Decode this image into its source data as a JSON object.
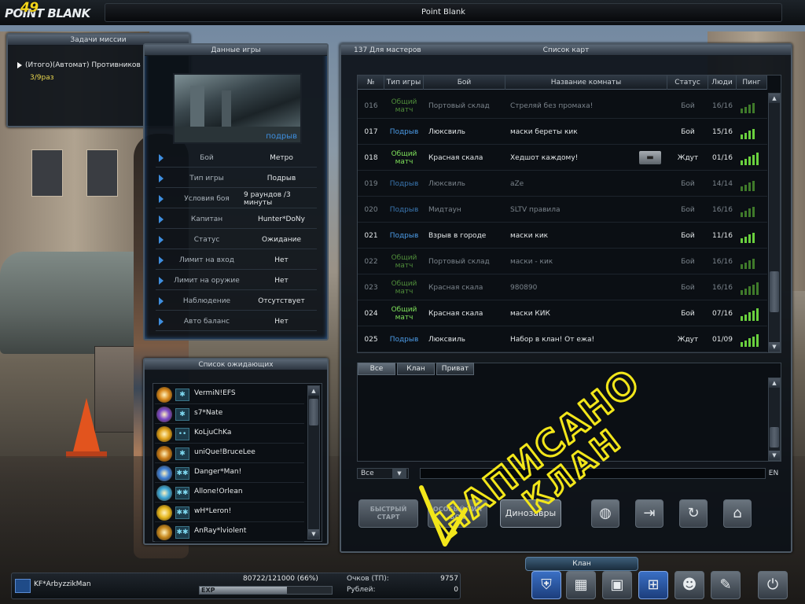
{
  "top_bar": {
    "logo_text": "POINT BLANK",
    "logo_number": "49",
    "title": "Point Blank"
  },
  "mission_panel": {
    "title": "Задачи миссии",
    "task": "(Итого)(Автомат) Противников",
    "progress": "3/9раз"
  },
  "game_data": {
    "title": "Данные игры",
    "map_mode_label": "подрыв",
    "rows": [
      {
        "key": "Бой",
        "value": "Метро"
      },
      {
        "key": "Тип игры",
        "value": "Подрыв"
      },
      {
        "key": "Условия боя",
        "value": "9 раундов /3 минуты"
      },
      {
        "key": "Капитан",
        "value": "Hunter*DoNy"
      },
      {
        "key": "Статус",
        "value": "Ожидание"
      },
      {
        "key": "Лимит на вход",
        "value": "Нет"
      },
      {
        "key": "Лимит на оружие",
        "value": "Нет"
      },
      {
        "key": "Наблюдение",
        "value": "Отсутствует"
      },
      {
        "key": "Авто баланс",
        "value": "Нет"
      }
    ]
  },
  "waiting_list": {
    "title": "Список ожидающих",
    "players": [
      {
        "name": "VermiN!EFS",
        "rank_color": "#d9891c",
        "clan_mark": "✱"
      },
      {
        "name": "s7*Nate",
        "rank_color": "#7b49c8",
        "clan_mark": "✱"
      },
      {
        "name": "KoLjuChKa",
        "rank_color": "#e0a21a",
        "clan_mark": "••"
      },
      {
        "name": "uniQue!BruceLee",
        "rank_color": "#c97c18",
        "clan_mark": "✱"
      },
      {
        "name": "Danger*Man!",
        "rank_color": "#3c7ed6",
        "clan_mark": "✱✱"
      },
      {
        "name": "Allone!Orlean",
        "rank_color": "#3ca6d8",
        "clan_mark": "✱✱"
      },
      {
        "name": "wH*Leron!",
        "rank_color": "#e8b81e",
        "clan_mark": "✱✱"
      },
      {
        "name": "AnRay*lviolent",
        "rank_color": "#c88a20",
        "clan_mark": "✱✱"
      }
    ]
  },
  "rooms_panel": {
    "server_label": "137 Для мастеров",
    "title": "Список карт",
    "columns": [
      "№",
      "Тип игры",
      "Бой",
      "Название комнаты",
      "Статус",
      "Люди",
      "Пинг"
    ],
    "rows": [
      {
        "no": "016",
        "mode": "Общий матч",
        "mode_kind": "g",
        "map": "Портовый склад",
        "name": "Стреляй без промаха!",
        "status": "Бой",
        "people": "16/16",
        "ping": 4,
        "dim": true
      },
      {
        "no": "017",
        "mode": "Подрыв",
        "mode_kind": "b",
        "map": "Люксвиль",
        "name": "маски береты кик",
        "status": "Бой",
        "people": "15/16",
        "ping": 4,
        "dim": false
      },
      {
        "no": "018",
        "mode": "Общий матч",
        "mode_kind": "g",
        "map": "Красная скала",
        "name": "Хедшот каждому!",
        "status": "Ждут",
        "people": "01/16",
        "ping": 5,
        "dim": false,
        "weapon": true
      },
      {
        "no": "019",
        "mode": "Подрыв",
        "mode_kind": "b",
        "map": "Люксвиль",
        "name": "aZe",
        "status": "Бой",
        "people": "14/14",
        "ping": 4,
        "dim": true
      },
      {
        "no": "020",
        "mode": "Подрыв",
        "mode_kind": "b",
        "map": "Мидтаун",
        "name": "SLTV правила",
        "status": "Бой",
        "people": "16/16",
        "ping": 4,
        "dim": true
      },
      {
        "no": "021",
        "mode": "Подрыв",
        "mode_kind": "b",
        "map": "Взрыв в городе",
        "name": "маски кик",
        "status": "Бой",
        "people": "11/16",
        "ping": 4,
        "dim": false
      },
      {
        "no": "022",
        "mode": "Общий матч",
        "mode_kind": "g",
        "map": "Портовый склад",
        "name": "маски - кик",
        "status": "Бой",
        "people": "16/16",
        "ping": 4,
        "dim": true
      },
      {
        "no": "023",
        "mode": "Общий матч",
        "mode_kind": "g",
        "map": "Красная скала",
        "name": "980890",
        "status": "Бой",
        "people": "16/16",
        "ping": 5,
        "dim": true
      },
      {
        "no": "024",
        "mode": "Общий матч",
        "mode_kind": "g",
        "map": "Красная скала",
        "name": "маски  КИК",
        "status": "Бой",
        "people": "07/16",
        "ping": 5,
        "dim": false
      },
      {
        "no": "025",
        "mode": "Подрыв",
        "mode_kind": "b",
        "map": "Люксвиль",
        "name": "Набор в клан! От ежа!",
        "status": "Ждут",
        "people": "01/09",
        "ping": 5,
        "dim": false
      }
    ]
  },
  "chat": {
    "tabs": [
      "Все",
      "Клан",
      "Приват"
    ],
    "channel": "Все",
    "lang": "EN"
  },
  "actions": {
    "quick_start": "БЫСТРЫЙ СТАРТ",
    "special_mode": "ОСОБЫЙ ТИП БОЯ",
    "dino": "Динозавры"
  },
  "player": {
    "nick": "KF*ArbyzzikMan",
    "xp_text": "80722/121000 (66%)",
    "xp_label": "EXP",
    "xp_fraction": 0.66,
    "points_label": "Очков (ТП):",
    "points": "9757",
    "rubles_label": "Рублей:",
    "rubles": "0"
  },
  "bottom_nav": {
    "tooltip": "Клан"
  },
  "overlay_scrawl": {
    "line1": "НАПИСАНО",
    "line2": "КЛАН",
    "color": "#f2e61a"
  }
}
